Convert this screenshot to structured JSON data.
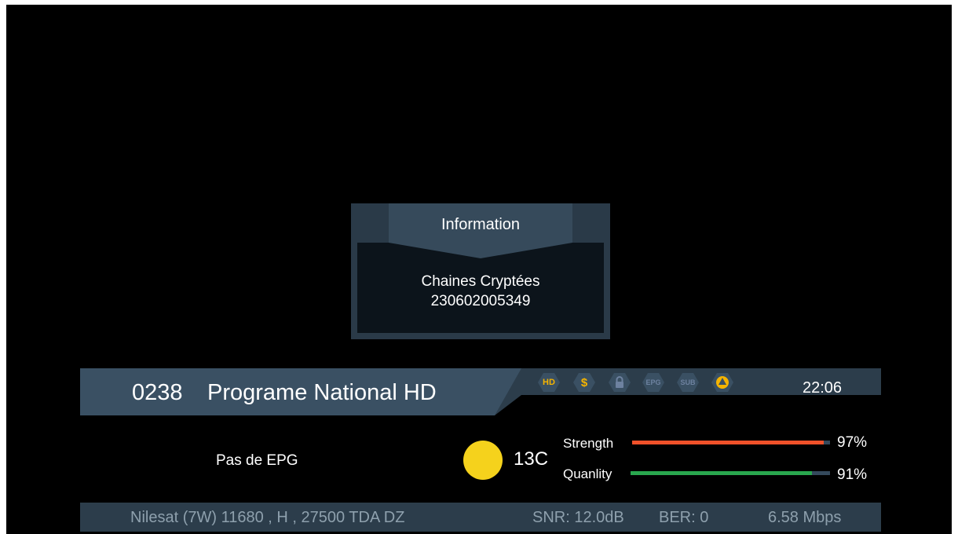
{
  "popup": {
    "title": "Information",
    "line1": "Chaines Cryptées",
    "line2": "230602005349"
  },
  "channel": {
    "number": "0238",
    "name": "Programe National HD",
    "time": "22:06",
    "badges": [
      "HD",
      "$",
      "lock-icon",
      "EPG",
      "SUB",
      "ci-icon"
    ]
  },
  "epg": {
    "text": "Pas de EPG"
  },
  "signal": {
    "temperature": "13C",
    "strength": {
      "label": "Strength",
      "value": "97%",
      "level": 0.97,
      "color": "#f0512a"
    },
    "quality": {
      "label": "Quanlity",
      "value": "91%",
      "level": 0.91,
      "color": "#29a74e"
    }
  },
  "status": {
    "transponder": "Nilesat (7W) 11680 , H , 27500 TDA DZ",
    "snr": "SNR: 12.0dB",
    "ber": "BER: 0",
    "bitrate": "6.58 Mbps"
  },
  "colors": {
    "badge_active": "#f5b400",
    "badge_inactive": "#6e82a0",
    "panel": "#2c3d4b",
    "sat_icon": "#f5d21c"
  }
}
